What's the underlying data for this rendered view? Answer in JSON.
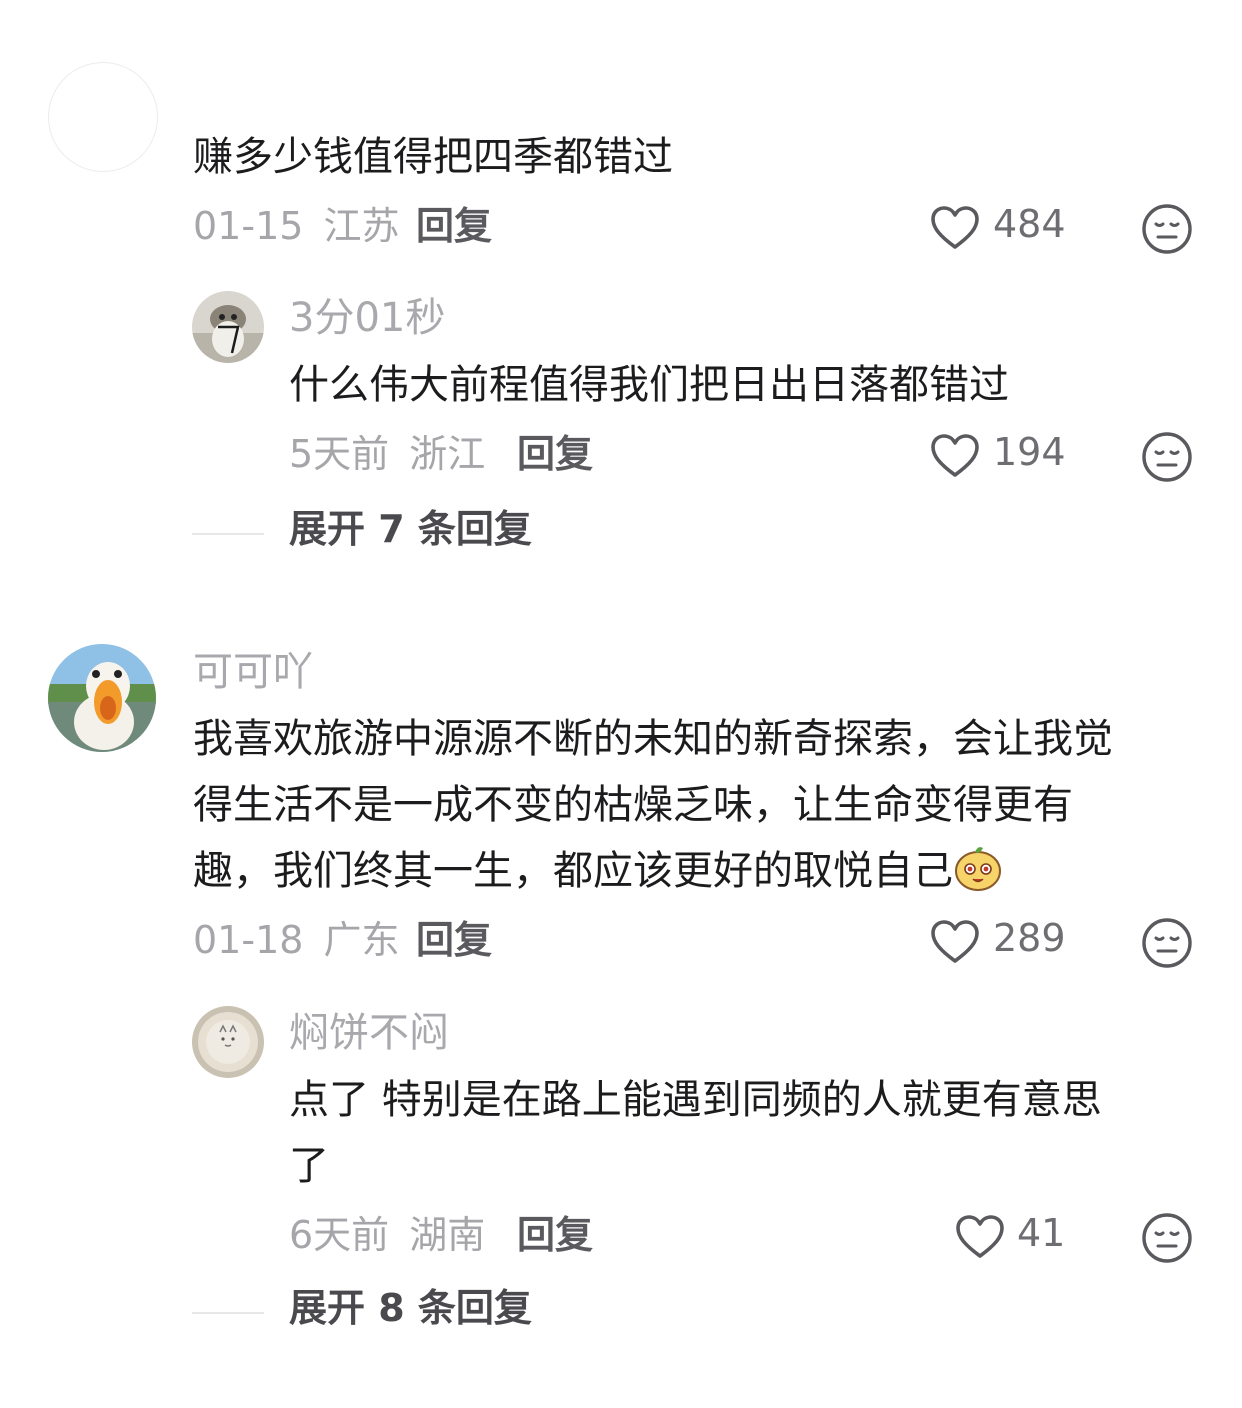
{
  "comments": [
    {
      "username": "",
      "content": "赚多少钱值得把四季都错过",
      "date": "01-15",
      "location": "江苏",
      "reply_label": "回复",
      "likes": "484",
      "replies": [
        {
          "username": "3分01秒",
          "content": "什么伟大前程值得我们把日出日落都错过",
          "date": "5天前",
          "location": "浙江",
          "reply_label": "回复",
          "likes": "194"
        }
      ],
      "expand_label": "展开 7 条回复"
    },
    {
      "username": "可可吖",
      "content_line1": "我喜欢旅游中源源不断的未知的新奇探索，会让我觉",
      "content_line2": "得生活不是一成不变的枯燥乏味，让生命变得更有",
      "content_line3": "趣，我们终其一生，都应该更好的取悦自己",
      "date": "01-18",
      "location": "广东",
      "reply_label": "回复",
      "likes": "289",
      "replies": [
        {
          "username": "焖饼不闷",
          "content_line1": "点了 特别是在路上能遇到同频的人就更有意思",
          "content_line2": "了",
          "date": "6天前",
          "location": "湖南",
          "reply_label": "回复",
          "likes": "41"
        }
      ],
      "expand_label": "展开 8 条回复"
    }
  ],
  "colors": {
    "meta_gray": "#a6a6aa",
    "text_dark": "#1c1c1e",
    "icon_gray": "#5a5a5e"
  },
  "icons": {
    "like": "heart-outline-icon",
    "dislike": "meh-face-icon",
    "emoji": "smiling-bun-emoji"
  }
}
